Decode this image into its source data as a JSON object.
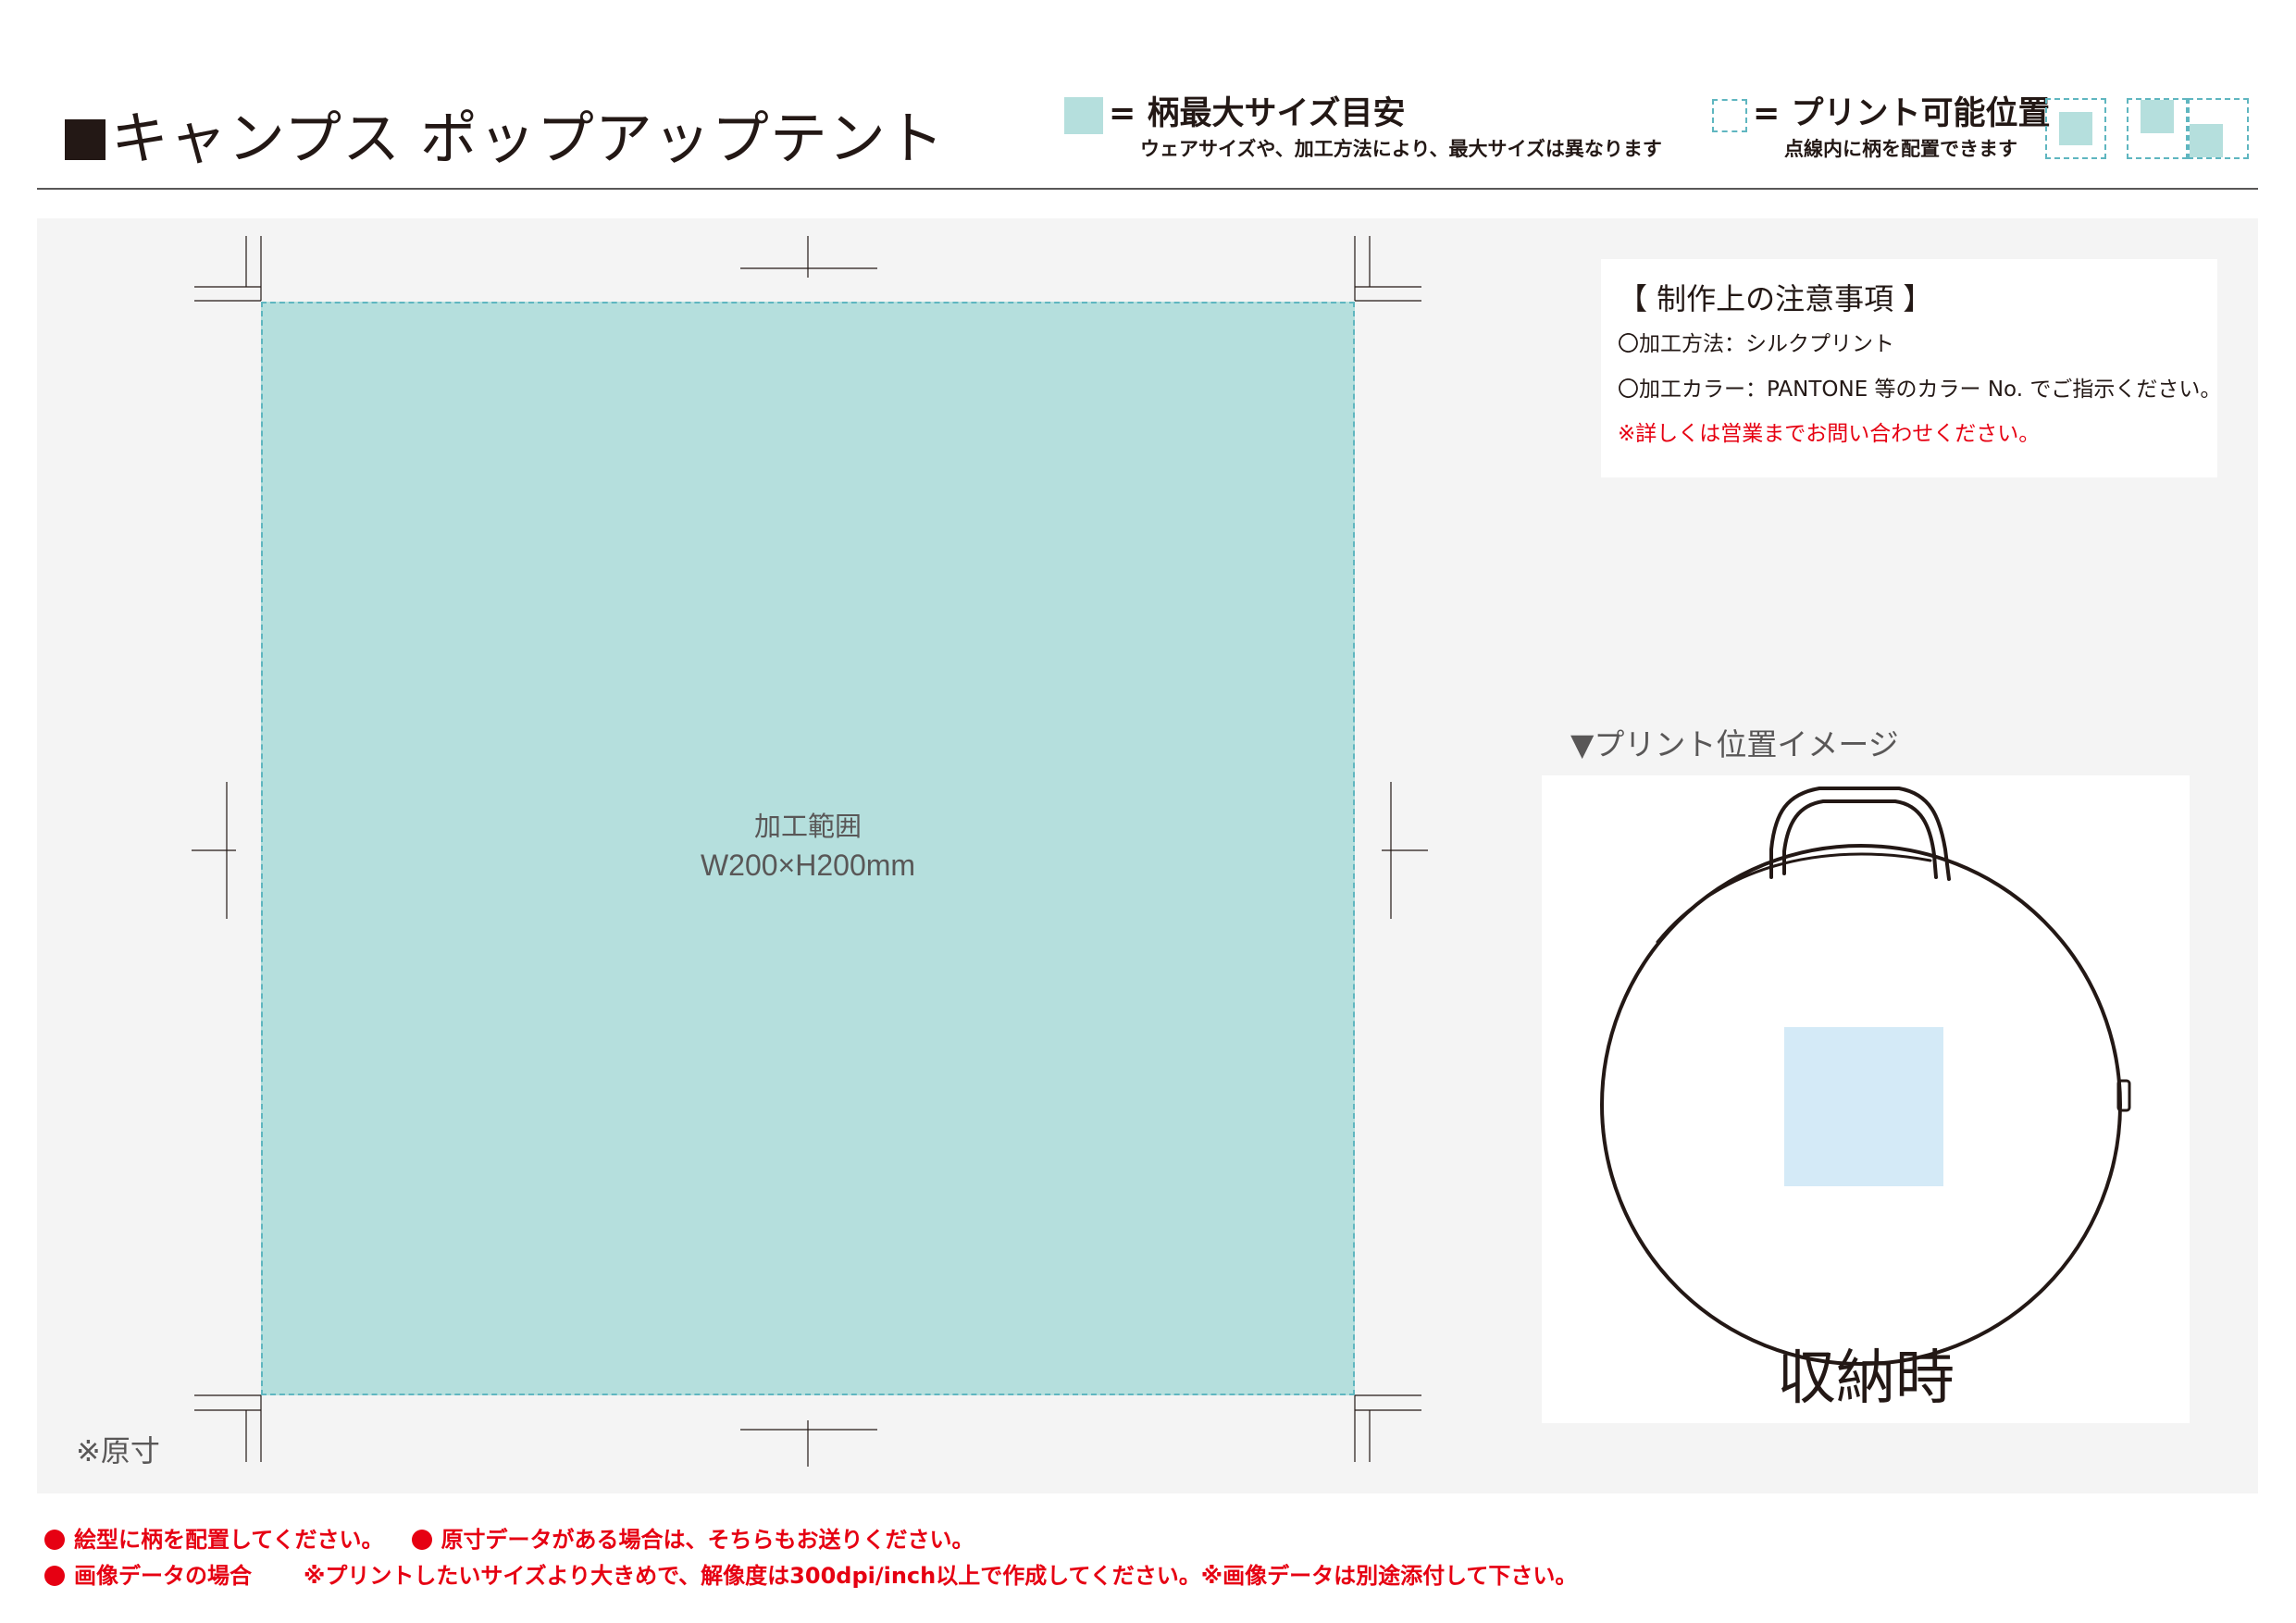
{
  "header": {
    "title": "キャンプス ポップアップテント",
    "legend_max": {
      "label": "= 柄最大サイズ目安",
      "note": "ウェアサイズや、加工方法により、最大サイズは異なります"
    },
    "legend_position": {
      "label": "= プリント可能位置",
      "note": "点線内に柄を配置できます"
    }
  },
  "template": {
    "area_label": "加工範囲",
    "area_size": "W200×H200mm",
    "original_size_note": "※原寸"
  },
  "notes": {
    "title": "【 制作上の注意事項 】",
    "method": "〇加工方法：シルクプリント",
    "color": "〇加工カラー：PANTONE 等のカラー No. でご指示ください。",
    "contact": "※詳しくは営業までお問い合わせください。"
  },
  "image": {
    "caption": "▼プリント位置イメージ",
    "stored_label": "収納時"
  },
  "footer": {
    "line1_part1": "絵型に柄を配置してください。",
    "line1_part2": "原寸データがある場合は、そちらもお送りください。",
    "line2_part1": "画像データの場合",
    "line2_part2": "※プリントしたいサイズより大きめで、解像度は300dpi/inch以上で作成してください。※画像データは別途添付して下さい。"
  },
  "colors": {
    "print_area": "#b5dfdd",
    "dashed_border": "#5fb6c0",
    "position_fill": "#d4eaf7",
    "accent_red": "#e60012",
    "panel_background": "#f4f4f4"
  }
}
